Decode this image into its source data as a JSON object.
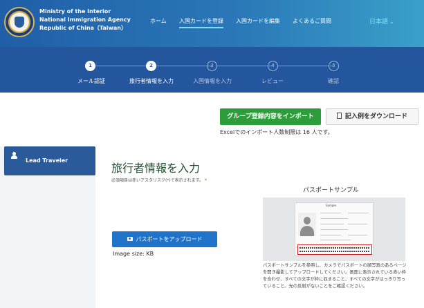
{
  "header": {
    "agency_lines": [
      "Ministry of the Interior",
      "National Immigration Agency",
      "Republic of China（Taiwan）"
    ],
    "nav": [
      {
        "label": "ホーム",
        "active": false
      },
      {
        "label": "入国カードを登録",
        "active": true
      },
      {
        "label": "入国カードを編集",
        "active": false
      },
      {
        "label": "よくあるご質問",
        "active": false
      }
    ],
    "language": "日本語"
  },
  "steps": [
    {
      "number": "1",
      "label": "メール認証",
      "done": true
    },
    {
      "number": "2",
      "label": "旅行者情報を入力",
      "done": true
    },
    {
      "number": "3",
      "label": "入国情報を入力",
      "done": false
    },
    {
      "number": "4",
      "label": "レビュー",
      "done": false
    },
    {
      "number": "5",
      "label": "確認",
      "done": false
    }
  ],
  "actions": {
    "import_label": "グループ登録内容をインポート",
    "download_label": "記入例をダウンロード",
    "import_note": "Excelでのインポート人数制限は 16 人です。"
  },
  "sidebar": {
    "item_label": "Lead Traveler"
  },
  "form": {
    "title": "旅行者情報を入力",
    "required_note": "必須項目は赤いアスタリスク(*)で表示されます。",
    "required_mark": "*",
    "upload_label": "パスポートをアップロード",
    "image_size": "Image size: KB"
  },
  "sample": {
    "title": "パスポートサンプル",
    "passport_header": "Sample",
    "description": "パスポートサンプルを参照し、カメラでパスポートの顔写真のあるページを開き撮影してアップロードしてください。画面に表示されている赤い枠を合わせ、すべての文字が枠に収まること、すべての文字がはっきり写っていること、光の反射がないことをご確認ください。"
  },
  "colors": {
    "header_start": "#1f5fa8",
    "header_end": "#3aa0c9",
    "steps_band": "#24569d",
    "import_button": "#2d9d3b",
    "upload_button": "#1f73c8",
    "sidebar": "#2b5a9b"
  }
}
